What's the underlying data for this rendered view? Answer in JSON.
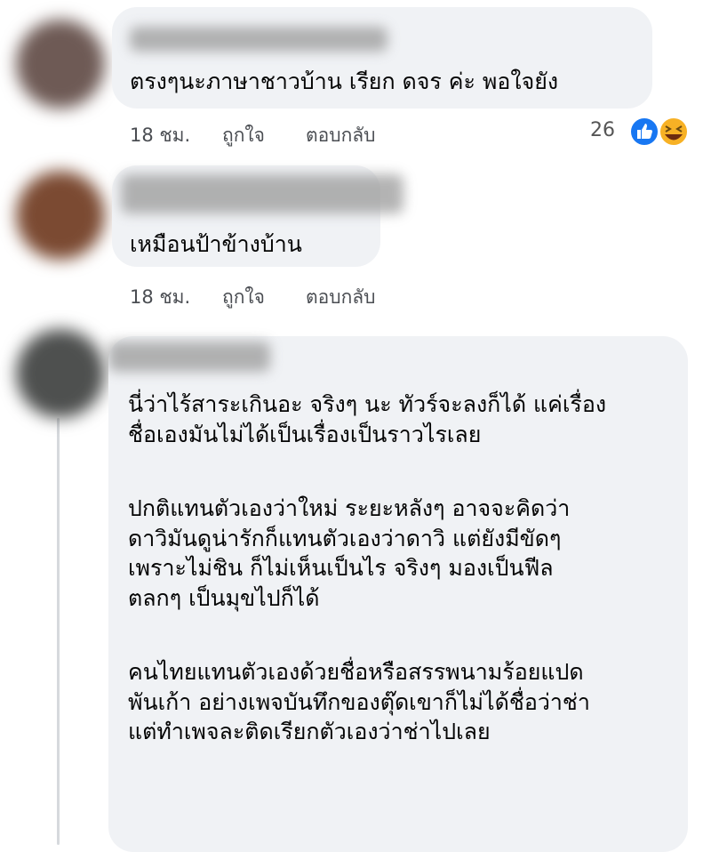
{
  "comments": [
    {
      "text_lines": [
        "ตรงๆนะภาษาชาวบ้าน เรียก ดจร  ค่ะ พอใจยัง"
      ],
      "time": "18 ชม.",
      "like_label": "ถูกใจ",
      "reply_label": "ตอบกลับ",
      "reaction_count": "26",
      "reactions": [
        "like-icon",
        "haha-icon"
      ]
    },
    {
      "text_lines": [
        "เหมือนป้าข้างบ้าน"
      ],
      "time": "18 ชม.",
      "like_label": "ถูกใจ",
      "reply_label": "ตอบกลับ"
    },
    {
      "paragraphs": [
        [
          "นี่ว่าไร้สาระเกินอะ จริงๆ นะ ทัวร์จะลงก็ได้ แค่เรื่อง",
          "ชื่อเองมันไม่ได้เป็นเรื่องเป็นราวไรเลย"
        ],
        [
          "ปกติแทนตัวเองว่าใหม่ ระยะหลังๆ อาจจะคิดว่า",
          "ดาวิมันดูน่ารักก็แทนตัวเองว่าดาวิ แต่ยังมีขัดๆ",
          "เพราะไม่ชิน ก็ไม่เห็นเป็นไร จริงๆ มองเป็นฟีล",
          "ตลกๆ เป็นมุขไปก็ได้"
        ],
        [
          "คนไทยแทนตัวเองด้วยชื่อหรือสรรพนามร้อยแปด",
          "พันเก้า อย่างเพจบันทึกของตุ๊ดเขาก็ไม่ได้ชื่อว่าช่า",
          "แต่ทำเพจละติดเรียกตัวเองว่าช่าไปเลย"
        ]
      ]
    }
  ],
  "colors": {
    "bubble_bg": "#f0f2f5",
    "meta_text": "#4a4d52",
    "like_blue": "#1877f2",
    "haha_yellow": "#f7b125"
  }
}
